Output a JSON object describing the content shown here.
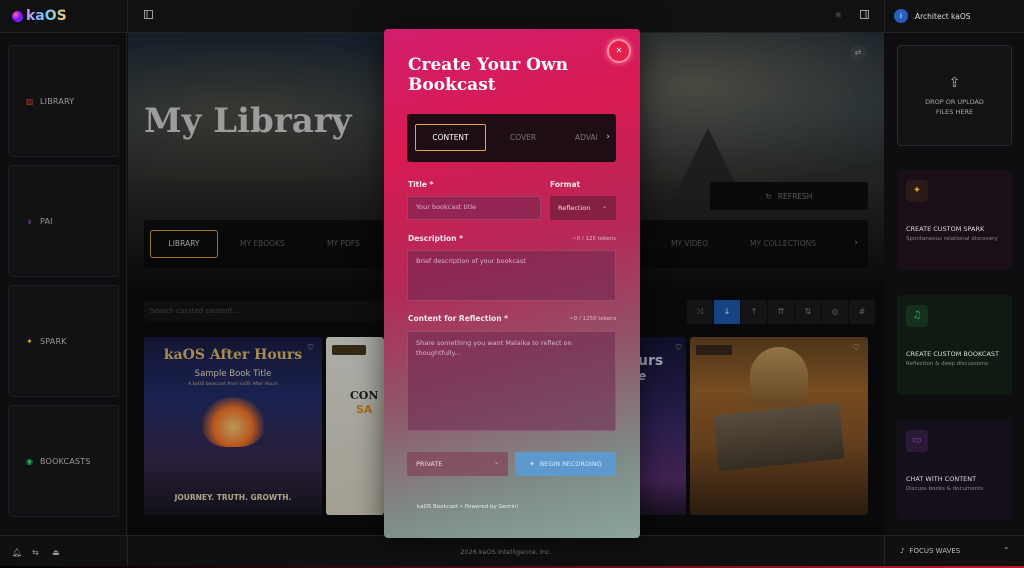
{
  "app": {
    "logo": "kaOS"
  },
  "topbar": {
    "user_initial": "i",
    "user_name": "Architect kaOS"
  },
  "leftnav": {
    "items": [
      {
        "label": "LIBRARY",
        "icon": "library-icon",
        "color": "#c0392b"
      },
      {
        "label": "PAI",
        "icon": "pai-icon",
        "color": "#8e44ad"
      },
      {
        "label": "SPARK",
        "icon": "spark-icon",
        "color": "#d4a030"
      },
      {
        "label": "BOOKCASTS",
        "icon": "podcast-icon",
        "color": "#27ae60"
      }
    ]
  },
  "hero": {
    "title": "My Library",
    "refresh_label": "REFRESH"
  },
  "library_tabs": {
    "active": "LIBRARY",
    "items": [
      "LIBRARY",
      "MY EBOOKS",
      "MY PDFS",
      "MY VIDEO",
      "MY COLLECTIONS"
    ]
  },
  "search": {
    "placeholder": "Search curated content..."
  },
  "cards": {
    "c1": {
      "title": "kaOS After Hours",
      "subtitle": "Sample Book Title",
      "line": "A kaOS bookcast from kaOS After Hours",
      "tagline": "JOURNEY. TRUTH. GROWTH."
    },
    "c2": {
      "big": "CON",
      "orange": "SA"
    },
    "c3": {
      "line1": "urs",
      "line2": "e"
    }
  },
  "rightbar": {
    "upload_label": "DROP OR UPLOAD FILES HERE",
    "cards": [
      {
        "title": "CREATE CUSTOM SPARK",
        "subtitle": "Spontaneous relational discovery",
        "icon": "spark-icon",
        "accent": "#d4a030",
        "bg": "#1a0e18"
      },
      {
        "title": "CREATE CUSTOM BOOKCAST",
        "subtitle": "Reflection & deep discussions",
        "icon": "headphones-icon",
        "accent": "#27ae60",
        "bg": "#0f1a13"
      },
      {
        "title": "CHAT WITH CONTENT",
        "subtitle": "Discuss books & documents",
        "icon": "chat-icon",
        "accent": "#8e44ad",
        "bg": "#150f1c"
      }
    ]
  },
  "footer": {
    "copyright": "2026 kaOS Intelligence, Inc.",
    "focus_label": "FOCUS WAVES"
  },
  "modal": {
    "title": "Create Your Own Bookcast",
    "tabs": [
      "CONTENT",
      "COVER",
      "ADVAI"
    ],
    "active_tab": "CONTENT",
    "title_label": "Title *",
    "title_placeholder": "Your bookcast title",
    "format_label": "Format",
    "format_value": "Reflection",
    "description_label": "Description *",
    "description_counter": "~0 / 125 tokens",
    "description_placeholder": "Brief description of your bookcast",
    "content_label": "Content for Reflection *",
    "content_counter": "~0 / 1250 tokens",
    "content_placeholder": "Share something you want Malaika to reflect on thoughtfully...",
    "privacy_value": "PRIVATE",
    "record_label": "BEGIN RECORDING",
    "footer": "kaOS Bookcast • Powered by Gemini"
  },
  "colors": {
    "accent_gold": "#d8a030",
    "modal_pink": "#d81a52",
    "active_blue": "#1f5fb4"
  }
}
